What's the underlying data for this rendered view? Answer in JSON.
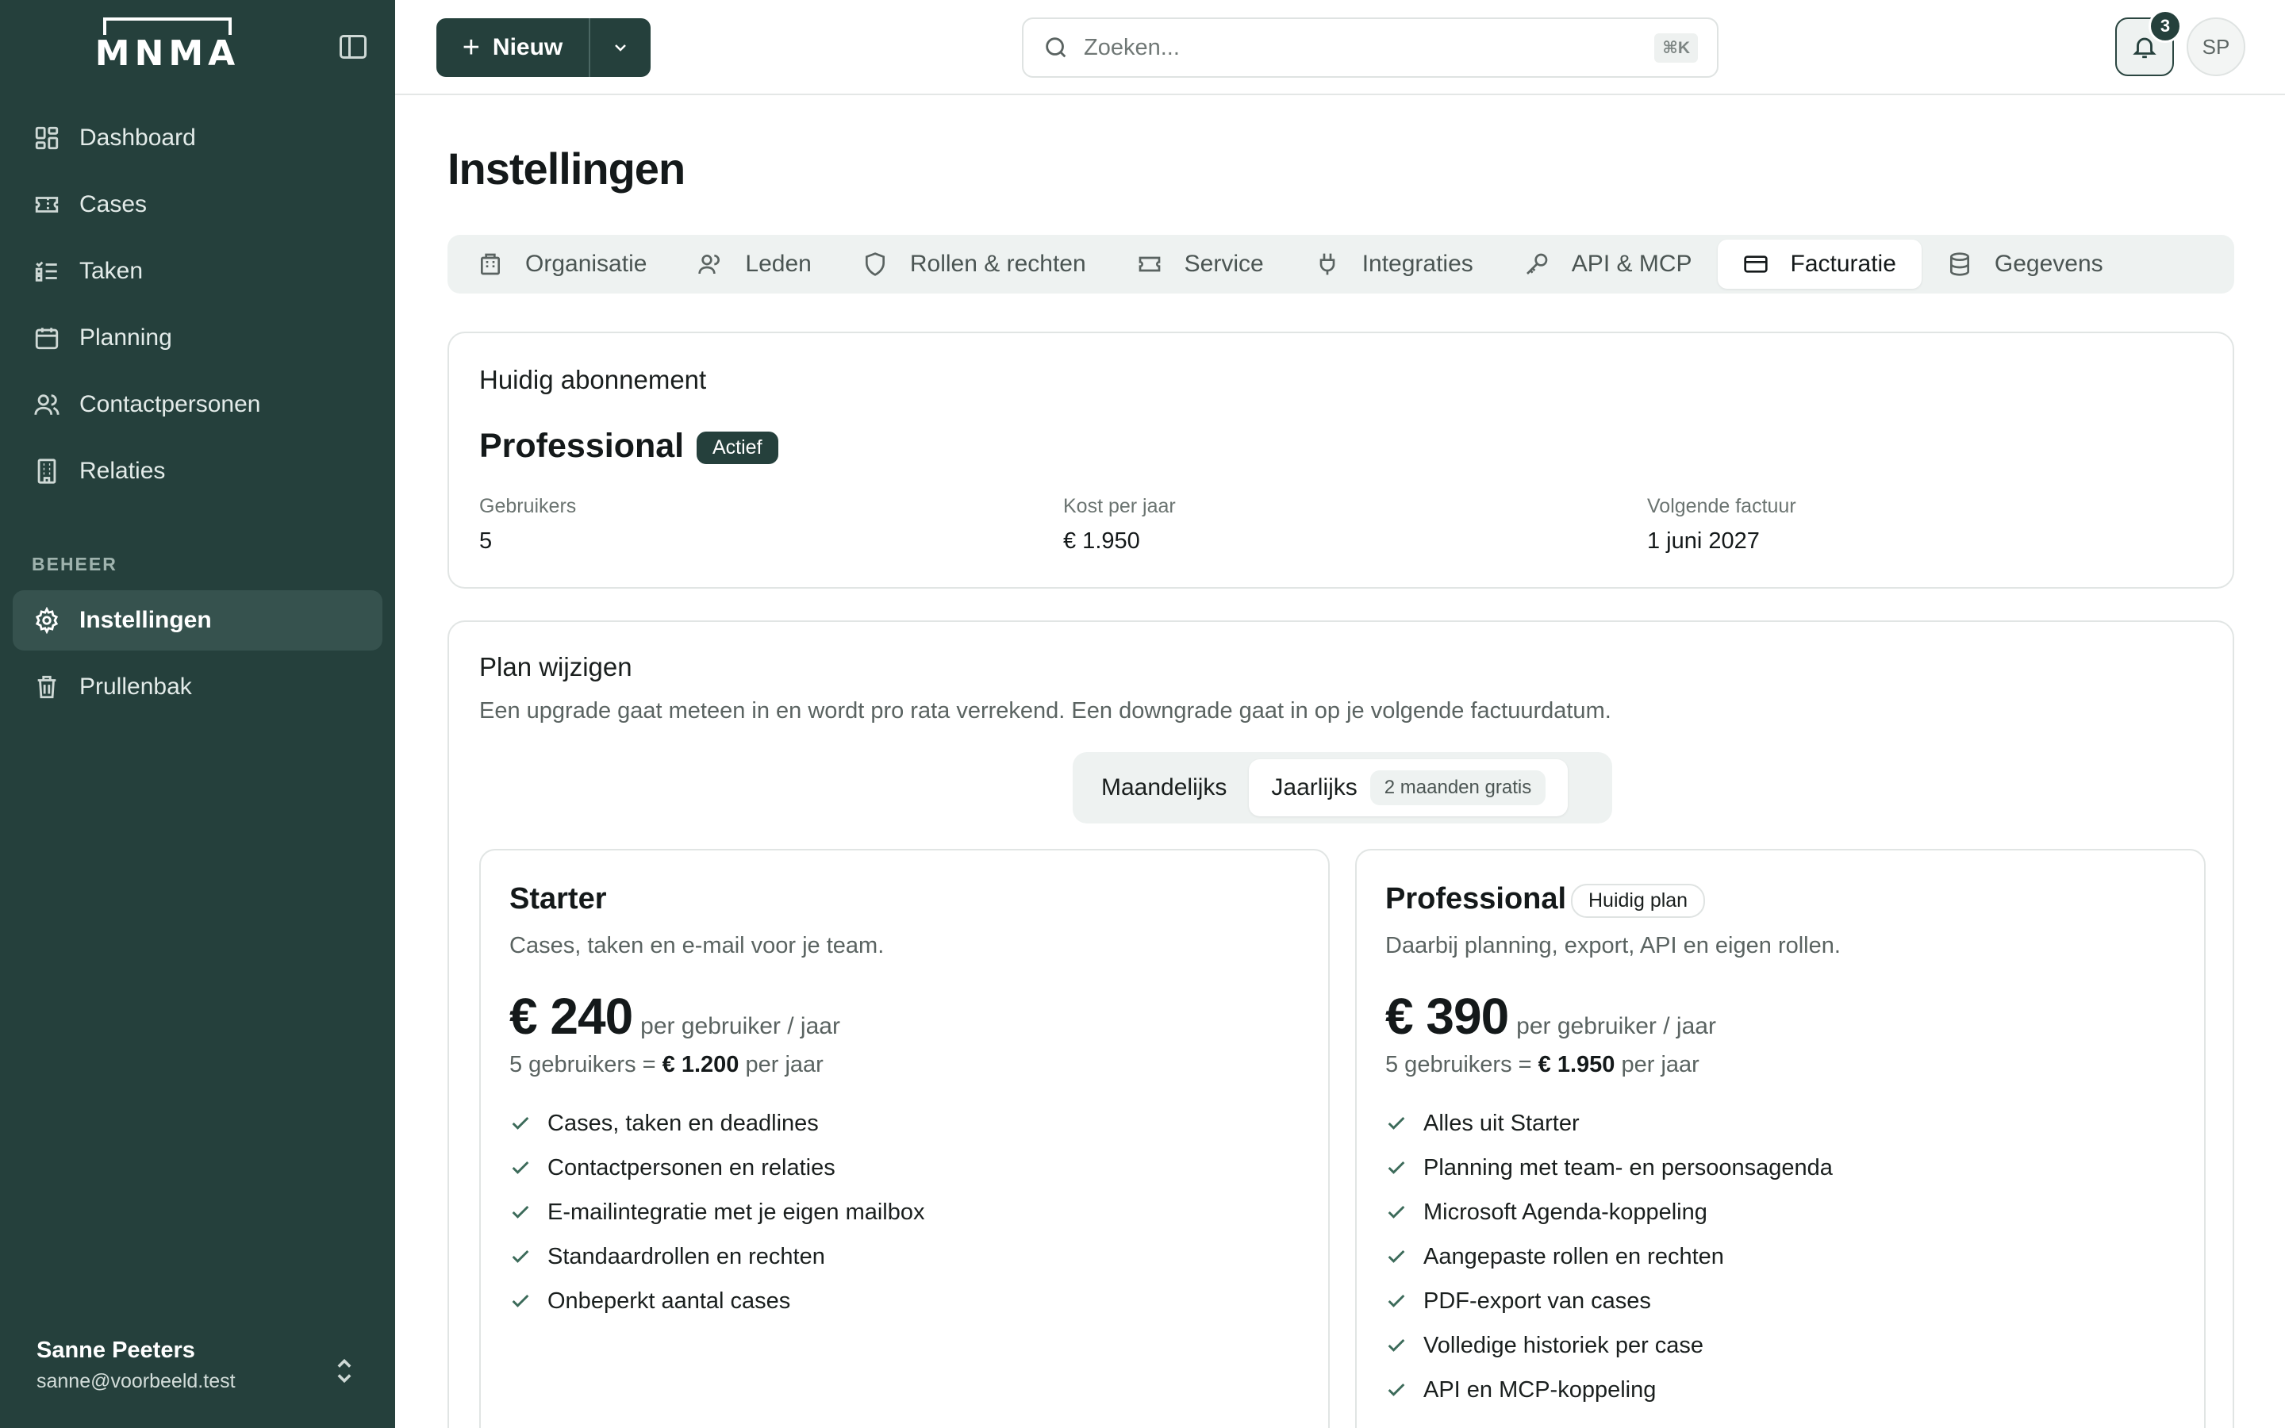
{
  "app": {
    "logo": "MNMA"
  },
  "sidebar": {
    "items": [
      {
        "label": "Dashboard",
        "icon": "dashboard-icon"
      },
      {
        "label": "Cases",
        "icon": "ticket-icon"
      },
      {
        "label": "Taken",
        "icon": "checklist-icon"
      },
      {
        "label": "Planning",
        "icon": "calendar-icon"
      },
      {
        "label": "Contactpersonen",
        "icon": "users-icon"
      },
      {
        "label": "Relaties",
        "icon": "building-icon"
      }
    ],
    "section_label": "BEHEER",
    "admin_items": [
      {
        "label": "Instellingen",
        "icon": "gear-icon",
        "active": true
      },
      {
        "label": "Prullenbak",
        "icon": "trash-icon"
      }
    ],
    "user": {
      "name": "Sanne Peeters",
      "email": "sanne@voorbeeld.test"
    }
  },
  "topbar": {
    "new_label": "Nieuw",
    "search_placeholder": "Zoeken...",
    "search_shortcut": "⌘K",
    "notification_count": "3",
    "avatar_initials": "SP"
  },
  "page": {
    "title": "Instellingen"
  },
  "tabs": [
    {
      "label": "Organisatie",
      "icon": "building-icon"
    },
    {
      "label": "Leden",
      "icon": "users-icon"
    },
    {
      "label": "Rollen & rechten",
      "icon": "shield-icon"
    },
    {
      "label": "Service",
      "icon": "ticket-icon"
    },
    {
      "label": "Integraties",
      "icon": "plug-icon"
    },
    {
      "label": "API & MCP",
      "icon": "key-icon"
    },
    {
      "label": "Facturatie",
      "icon": "credit-card-icon",
      "active": true
    },
    {
      "label": "Gegevens",
      "icon": "database-icon"
    }
  ],
  "subscription": {
    "title": "Huidig abonnement",
    "plan": "Professional",
    "status": "Actief",
    "stats": [
      {
        "label": "Gebruikers",
        "value": "5"
      },
      {
        "label": "Kost per jaar",
        "value": "€ 1.950"
      },
      {
        "label": "Volgende factuur",
        "value": "1 juni 2027"
      }
    ]
  },
  "change_plan": {
    "title": "Plan wijzigen",
    "subtitle": "Een upgrade gaat meteen in en wordt pro rata verrekend. Een downgrade gaat in op je volgende factuurdatum.",
    "toggle": {
      "monthly": "Maandelijks",
      "yearly": "Jaarlijks",
      "yearly_badge": "2 maanden gratis",
      "selected": "yearly"
    },
    "plans": [
      {
        "name": "Starter",
        "description": "Cases, taken en e-mail voor je team.",
        "price": "€ 240",
        "unit": "per gebruiker / jaar",
        "total_prefix": "5 gebruikers =",
        "total_amount": "€ 1.200",
        "total_suffix": "per jaar",
        "features": [
          "Cases, taken en deadlines",
          "Contactpersonen en relaties",
          "E-mailintegratie met je eigen mailbox",
          "Standaardrollen en rechten",
          "Onbeperkt aantal cases"
        ]
      },
      {
        "name": "Professional",
        "badge": "Huidig plan",
        "description": "Daarbij planning, export, API en eigen rollen.",
        "price": "€ 390",
        "unit": "per gebruiker / jaar",
        "total_prefix": "5 gebruikers =",
        "total_amount": "€ 1.950",
        "total_suffix": "per jaar",
        "features": [
          "Alles uit Starter",
          "Planning met team- en persoonsagenda",
          "Microsoft Agenda-koppeling",
          "Aangepaste rollen en rechten",
          "PDF-export van cases",
          "Volledige historiek per case",
          "API en MCP-koppeling"
        ]
      }
    ]
  },
  "colors": {
    "primary": "#25403c",
    "sidebar_active": "#36524e",
    "tab_bg": "#eef2f1"
  }
}
